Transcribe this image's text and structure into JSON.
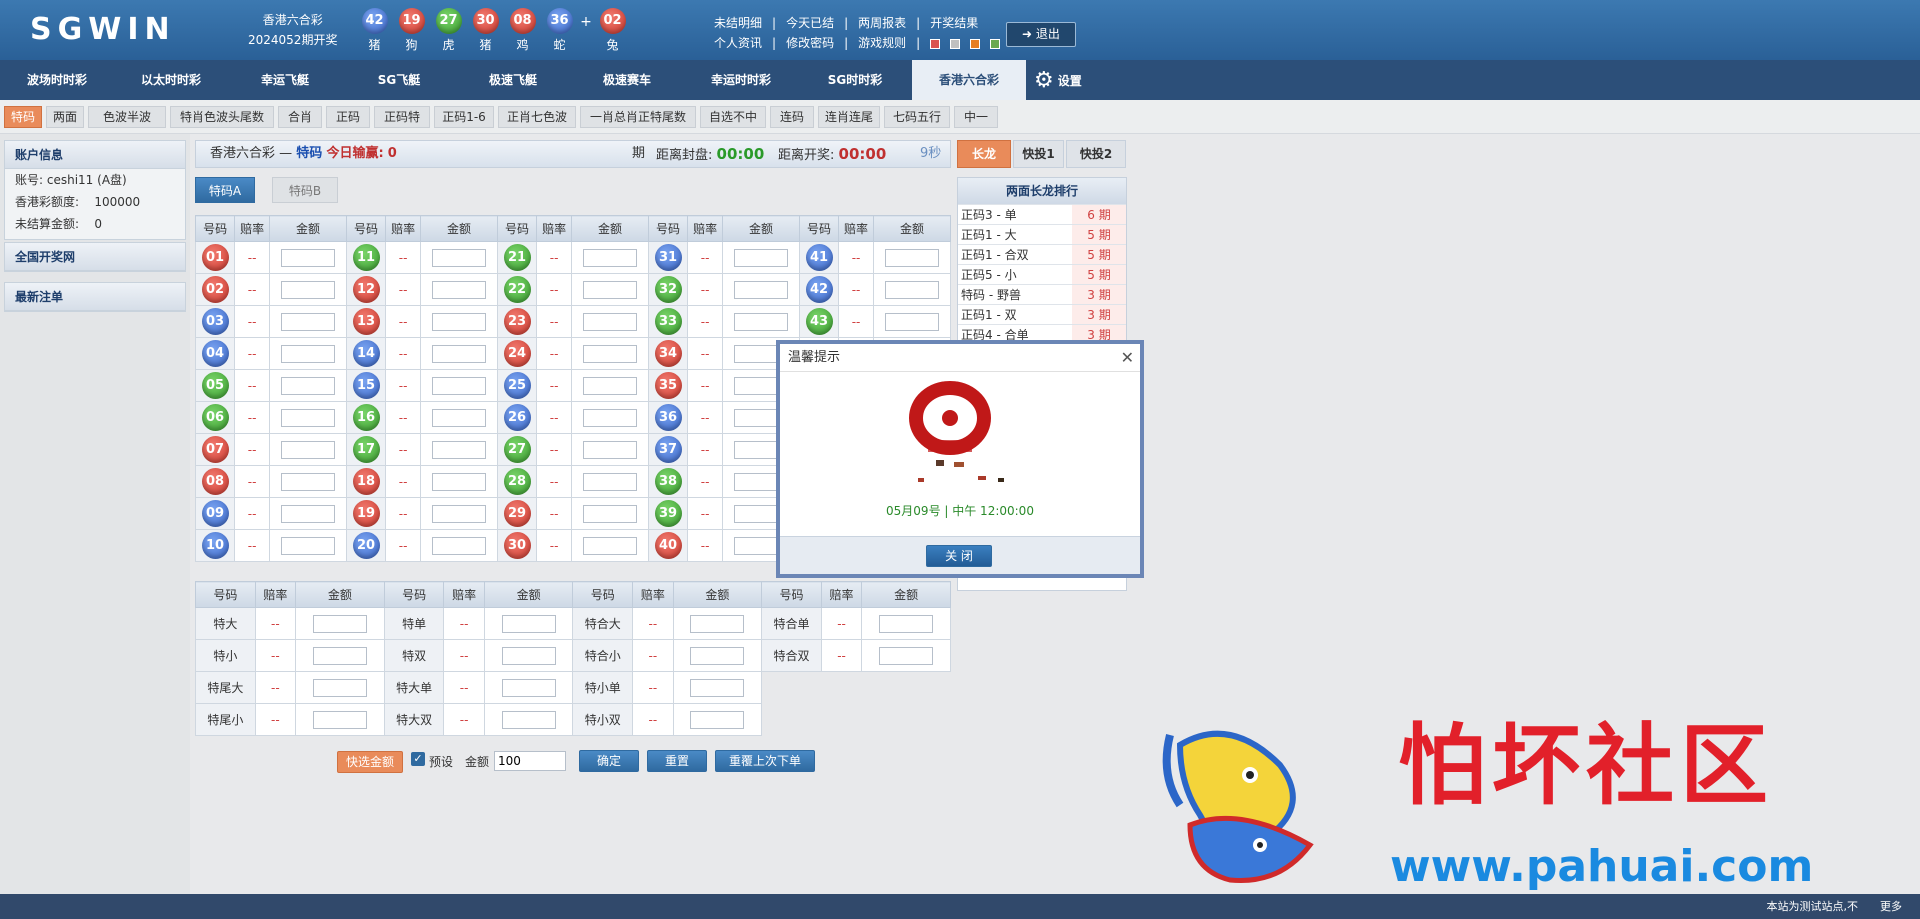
{
  "header": {
    "logo": "SGWIN",
    "lottery_name": "香港六合彩",
    "period": "2024052期开奖",
    "balls": [
      {
        "num": "42",
        "zodiac": "猪",
        "color": "b"
      },
      {
        "num": "19",
        "zodiac": "狗",
        "color": "r"
      },
      {
        "num": "27",
        "zodiac": "虎",
        "color": "g"
      },
      {
        "num": "30",
        "zodiac": "猪",
        "color": "r"
      },
      {
        "num": "08",
        "zodiac": "鸡",
        "color": "r"
      },
      {
        "num": "36",
        "zodiac": "蛇",
        "color": "b"
      }
    ],
    "plus": "+",
    "special_ball": {
      "num": "02",
      "zodiac": "兔",
      "color": "r"
    },
    "links_row1": [
      "未结明细",
      "今天已结",
      "两周报表",
      "开奖结果"
    ],
    "links_row2": [
      "个人资讯",
      "修改密码",
      "游戏规则"
    ],
    "separator": "|",
    "logout": "退出",
    "logout_icon": "logout-icon"
  },
  "nav": {
    "items": [
      "波场时时彩",
      "以太时时彩",
      "幸运飞艇",
      "SG飞艇",
      "极速飞艇",
      "极速赛车",
      "幸运时时彩",
      "SG时时彩",
      "香港六合彩"
    ],
    "active": "香港六合彩",
    "settings": "设置",
    "settings_icon": "gear-icon"
  },
  "subtabs": {
    "items": [
      "特码",
      "两面",
      "色波半波",
      "特肖色波头尾数",
      "合肖",
      "正码",
      "正码特",
      "正码1-6",
      "正肖七色波",
      "一肖总肖正特尾数",
      "自选不中",
      "连码",
      "连肖连尾",
      "七码五行",
      "中一"
    ],
    "active": "特码"
  },
  "left": {
    "account_title": "账户信息",
    "account_label": "账号:",
    "account_value": "ceshi11 (A盘)",
    "credit_label": "香港彩额度:",
    "credit_value": "100000",
    "unsettled_label": "未结算金额:",
    "unsettled_value": "0",
    "nationwide": "全国开奖网",
    "latest": "最新注单"
  },
  "panel": {
    "lottery": "香港六合彩",
    "dash": "—",
    "play": "特码",
    "today_label": "今日输赢:",
    "today_value": "0",
    "period_label": "期",
    "close_label": "距离封盘:",
    "close_time": "00:00",
    "open_label": "距离开奖:",
    "open_time": "00:00",
    "refresh": "9秒",
    "tab_a": "特码A",
    "tab_b": "特码B"
  },
  "table1": {
    "headers": [
      "号码",
      "赔率",
      "金额"
    ],
    "odds_placeholder": "--",
    "columns": [
      [
        {
          "n": "01",
          "c": "r"
        },
        {
          "n": "02",
          "c": "r"
        },
        {
          "n": "03",
          "c": "b"
        },
        {
          "n": "04",
          "c": "b"
        },
        {
          "n": "05",
          "c": "g"
        },
        {
          "n": "06",
          "c": "g"
        },
        {
          "n": "07",
          "c": "r"
        },
        {
          "n": "08",
          "c": "r"
        },
        {
          "n": "09",
          "c": "b"
        },
        {
          "n": "10",
          "c": "b"
        }
      ],
      [
        {
          "n": "11",
          "c": "g"
        },
        {
          "n": "12",
          "c": "r"
        },
        {
          "n": "13",
          "c": "r"
        },
        {
          "n": "14",
          "c": "b"
        },
        {
          "n": "15",
          "c": "b"
        },
        {
          "n": "16",
          "c": "g"
        },
        {
          "n": "17",
          "c": "g"
        },
        {
          "n": "18",
          "c": "r"
        },
        {
          "n": "19",
          "c": "r"
        },
        {
          "n": "20",
          "c": "b"
        }
      ],
      [
        {
          "n": "21",
          "c": "g"
        },
        {
          "n": "22",
          "c": "g"
        },
        {
          "n": "23",
          "c": "r"
        },
        {
          "n": "24",
          "c": "r"
        },
        {
          "n": "25",
          "c": "b"
        },
        {
          "n": "26",
          "c": "b"
        },
        {
          "n": "27",
          "c": "g"
        },
        {
          "n": "28",
          "c": "g"
        },
        {
          "n": "29",
          "c": "r"
        },
        {
          "n": "30",
          "c": "r"
        }
      ],
      [
        {
          "n": "31",
          "c": "b"
        },
        {
          "n": "32",
          "c": "g"
        },
        {
          "n": "33",
          "c": "g"
        },
        {
          "n": "34",
          "c": "r"
        },
        {
          "n": "35",
          "c": "r"
        },
        {
          "n": "36",
          "c": "b"
        },
        {
          "n": "37",
          "c": "b"
        },
        {
          "n": "38",
          "c": "g"
        },
        {
          "n": "39",
          "c": "g"
        },
        {
          "n": "40",
          "c": "r"
        }
      ],
      [
        {
          "n": "41",
          "c": "b"
        },
        {
          "n": "42",
          "c": "b"
        },
        {
          "n": "43",
          "c": "g"
        }
      ]
    ]
  },
  "table2": {
    "headers": [
      "号码",
      "赔率",
      "金额"
    ],
    "rows": [
      [
        "特大",
        "特单",
        "特合大",
        "特合单"
      ],
      [
        "特小",
        "特双",
        "特合小",
        "特合双"
      ],
      [
        "特尾大",
        "特大单",
        "特小单",
        ""
      ],
      [
        "特尾小",
        "特大双",
        "特小双",
        ""
      ]
    ]
  },
  "actions": {
    "quick_amount": "快选金额",
    "preset": "预设",
    "amount_label": "金额",
    "amount_value": "100",
    "confirm": "确定",
    "reset": "重置",
    "repeat": "重覆上次下单"
  },
  "right": {
    "tabs": [
      "长龙",
      "快投1",
      "快投2"
    ],
    "active": "长龙",
    "title": "两面长龙排行",
    "rows": [
      {
        "name": "正码3 - 单",
        "val": "6 期"
      },
      {
        "name": "正码1 - 大",
        "val": "5 期"
      },
      {
        "name": "正码1 - 合双",
        "val": "5 期"
      },
      {
        "name": "正码5 - 小",
        "val": "5 期"
      },
      {
        "name": "特码 - 野兽",
        "val": "3 期"
      },
      {
        "name": "正码1 - 双",
        "val": "3 期"
      },
      {
        "name": "正码4 - 合单",
        "val": "3 期"
      }
    ]
  },
  "modal": {
    "title": "温馨提示",
    "date_text": "05月09号 | 中午 12:00:00",
    "close_button": "关 闭"
  },
  "footer": {
    "notice": "本站为测试站点,不",
    "more": "更多"
  },
  "watermark": {
    "title": "怕坏社区",
    "url": "www.pahuai.com"
  },
  "colors": {
    "accent_orange": "#e98b5a",
    "nav_blue": "#2c4f79",
    "header_blue": "#3c79b1",
    "red": "#d04040",
    "green": "#2a9a2a"
  }
}
